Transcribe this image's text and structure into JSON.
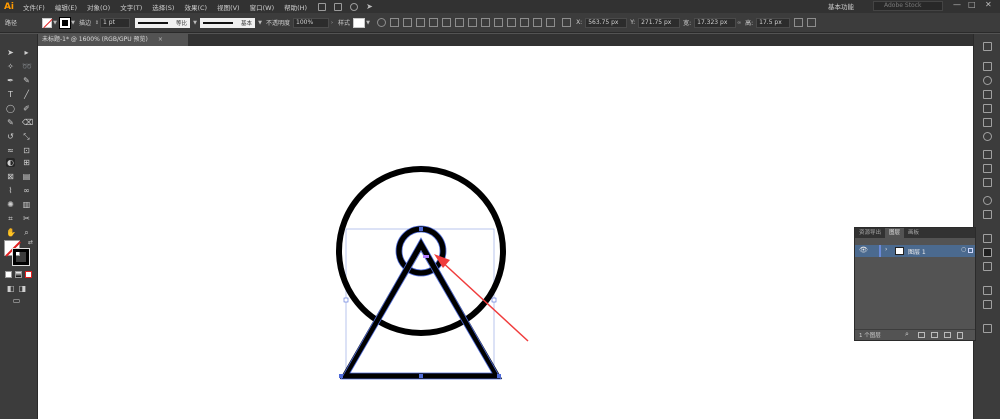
{
  "app": {
    "logo": "Ai",
    "menu": [
      "文件(F)",
      "编辑(E)",
      "对象(O)",
      "文字(T)",
      "选择(S)",
      "效果(C)",
      "视图(V)",
      "窗口(W)",
      "帮助(H)"
    ],
    "workspace": "基本功能",
    "search_placeholder": "Adobe Stock",
    "window_controls": [
      "—",
      "□",
      "✕"
    ]
  },
  "control_bar": {
    "object_type": "路径",
    "stroke_label": "描边",
    "stroke_weight": "1 pt",
    "profile_label": "等比",
    "brush_label": "基本",
    "opacity_label": "不透明度",
    "opacity_value": "100%",
    "style_label": "样式",
    "x_label": "X:",
    "x_value": "563.75 px",
    "y_label": "Y:",
    "y_value": "271.75 px",
    "w_label": "宽:",
    "w_value": "17.323 px",
    "h_label": "高:",
    "h_value": "17.5 px"
  },
  "document": {
    "tab_title": "未标题-1* @ 1600% (RGB/GPU 预览)",
    "tab_close": "×"
  },
  "layers_panel": {
    "tabs": [
      {
        "label": "资源导出",
        "active": false
      },
      {
        "label": "图层",
        "active": true
      },
      {
        "label": "画板",
        "active": false
      }
    ],
    "layer_name": "图层 1",
    "footer_count": "1 个图层"
  },
  "colors": {
    "accent": "#ff9a00",
    "selection": "#4f6bd8",
    "arrow": "#f03c3c",
    "layer_highlight": "#4b6a8f"
  }
}
